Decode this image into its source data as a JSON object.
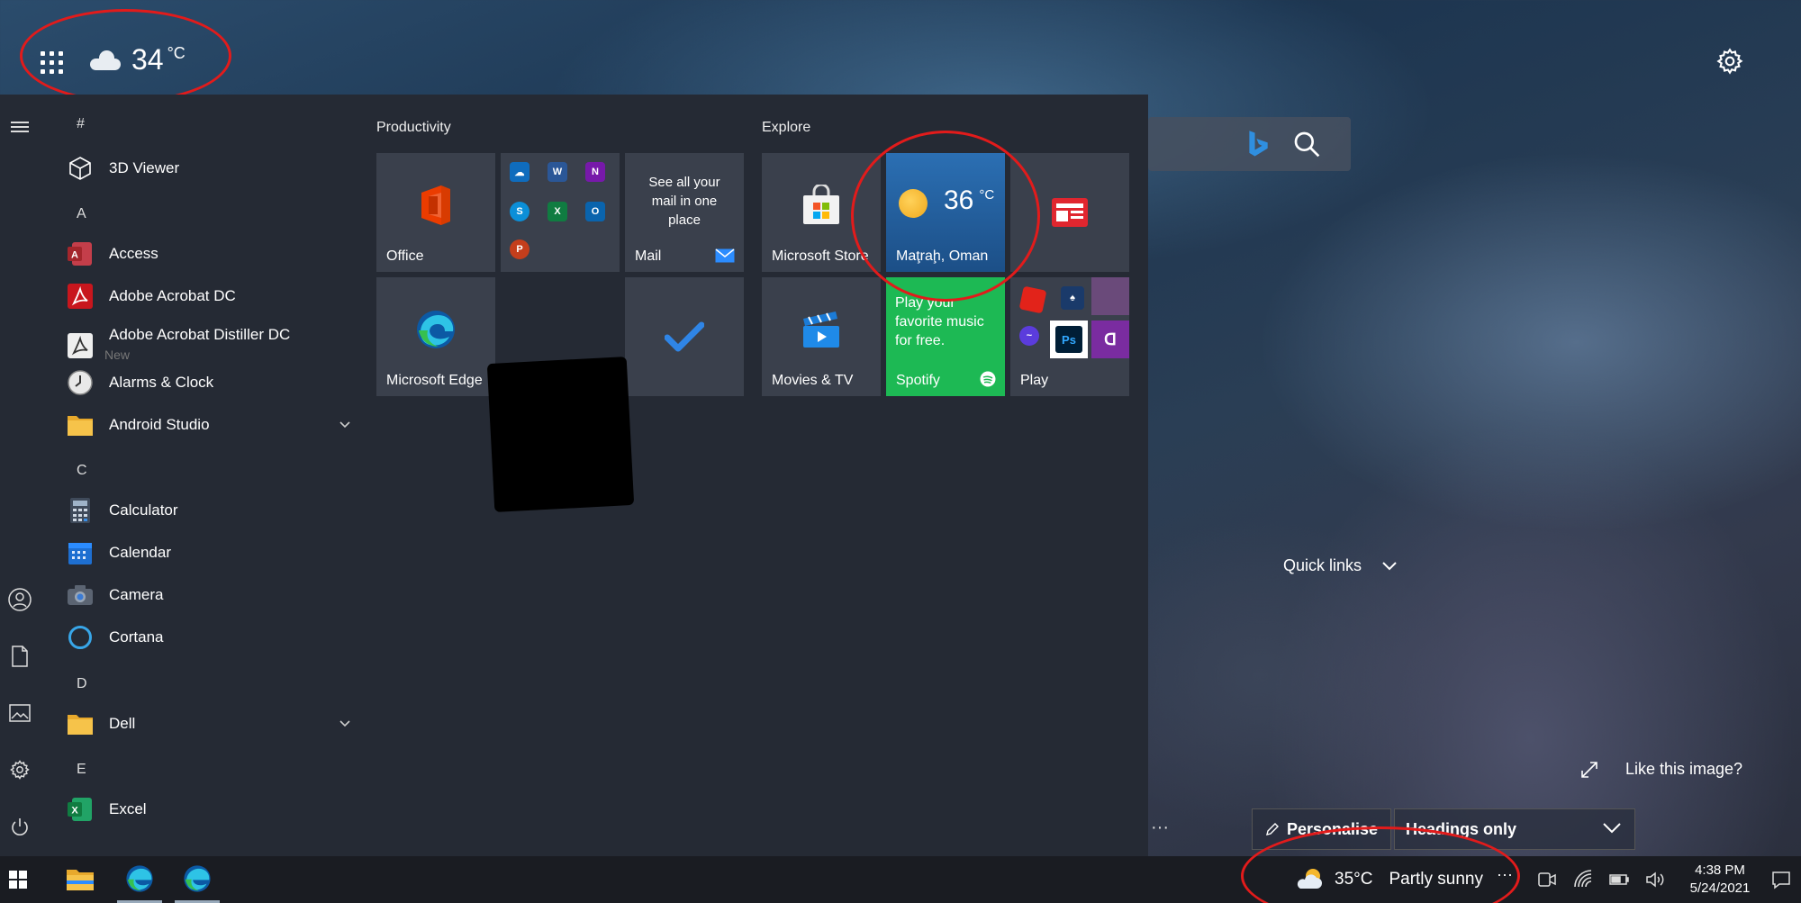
{
  "top": {
    "temperature": "34",
    "unit": "°C"
  },
  "left_rail": {
    "icons": [
      "hamburger-icon",
      "user-icon",
      "document-icon",
      "pictures-icon",
      "gear-icon",
      "power-icon"
    ]
  },
  "app_list": {
    "items": [
      {
        "type": "letter",
        "text": "#"
      },
      {
        "type": "app",
        "name": "3D Viewer",
        "icon": "cube-icon"
      },
      {
        "type": "letter",
        "text": "A"
      },
      {
        "type": "app",
        "name": "Access",
        "icon": "access-icon"
      },
      {
        "type": "app",
        "name": "Adobe Acrobat DC",
        "icon": "acrobat-icon"
      },
      {
        "type": "app",
        "name": "Adobe Acrobat Distiller DC",
        "sub": "New",
        "icon": "distiller-icon"
      },
      {
        "type": "app",
        "name": "Alarms & Clock",
        "icon": "clock-icon"
      },
      {
        "type": "app",
        "name": "Android Studio",
        "icon": "folder-icon",
        "expand": true
      },
      {
        "type": "letter",
        "text": "C"
      },
      {
        "type": "app",
        "name": "Calculator",
        "icon": "calculator-icon"
      },
      {
        "type": "app",
        "name": "Calendar",
        "icon": "calendar-icon"
      },
      {
        "type": "app",
        "name": "Camera",
        "icon": "camera-icon"
      },
      {
        "type": "app",
        "name": "Cortana",
        "icon": "cortana-icon"
      },
      {
        "type": "letter",
        "text": "D"
      },
      {
        "type": "app",
        "name": "Dell",
        "icon": "folder-icon",
        "expand": true
      },
      {
        "type": "letter",
        "text": "E"
      },
      {
        "type": "app",
        "name": "Excel",
        "icon": "excel-icon"
      }
    ]
  },
  "groups": {
    "productivity": "Productivity",
    "explore": "Explore"
  },
  "tiles": {
    "office": "Office",
    "mail_text": "See all your mail in one place",
    "mail": "Mail",
    "edge": "Microsoft Edge",
    "store": "Microsoft Store",
    "weather_temp": "36",
    "weather_unit": "°C",
    "weather_location": "Maţraḩ, Oman",
    "spotify_text": "Play your favorite music for free.",
    "spotify": "Spotify",
    "movies": "Movies & TV",
    "play": "Play"
  },
  "news": {
    "quick_links": "Quick links",
    "like_image": "Like this image?",
    "dots": "···",
    "personalise": "Personalise",
    "headings": "Headings only"
  },
  "taskbar": {
    "weather_temp": "35°C",
    "weather_desc": "Partly sunny",
    "more": "···",
    "time": "4:38 PM",
    "date": "5/24/2021"
  },
  "colors": {
    "annotation": "#e21b1b",
    "start_bg": "#252a34",
    "tile_bg": "#3a404c",
    "spotify": "#1db954",
    "weather_tile": "#1f5c9a"
  }
}
